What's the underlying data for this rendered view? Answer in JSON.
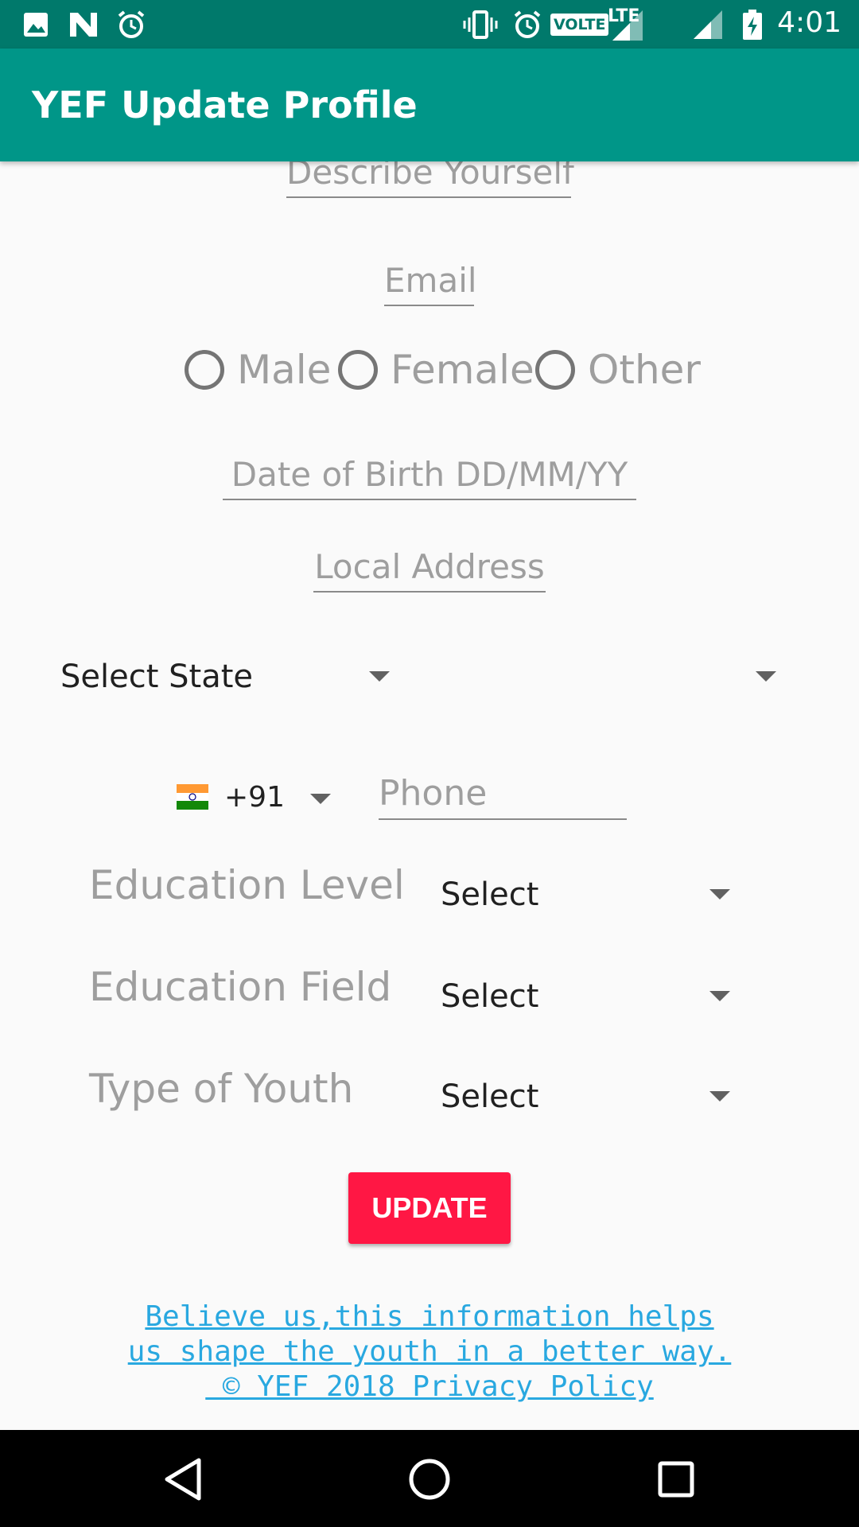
{
  "status_bar": {
    "time": "4:01",
    "left_icons": [
      "image-icon",
      "n-icon",
      "alarm-icon"
    ],
    "right_icons": [
      "vibrate-icon",
      "alarm-icon",
      "volte-icon",
      "lte-signal-icon",
      "signal-icon",
      "battery-charging-icon"
    ],
    "volte_label": "VOLTE",
    "lte_label": "LTE"
  },
  "app_bar": {
    "title": "YEF Update Profile"
  },
  "form": {
    "describe_placeholder": "Describe Yourself",
    "email_placeholder": "Email",
    "gender_options": [
      "Male",
      "Female",
      "Other"
    ],
    "dob_placeholder": "Date of Birth DD/MM/YY",
    "address_placeholder": "Local Address",
    "state_select": "Select State",
    "country_code": "+91",
    "phone_placeholder": "Phone",
    "education_level_label": "Education Level",
    "education_level_value": "Select",
    "education_field_label": "Education Field",
    "education_field_value": "Select",
    "youth_type_label": "Type of Youth",
    "youth_type_value": "Select",
    "update_button": "UPDATE"
  },
  "footer": {
    "line1": "Believe us,this information helps",
    "line2": "us shape the youth in a better way.",
    "line3": " © YEF 2018 Privacy Policy"
  },
  "colors": {
    "status_bar": "#00796b",
    "app_bar": "#009688",
    "accent_button": "#ff1744",
    "link": "#29a8e0"
  }
}
